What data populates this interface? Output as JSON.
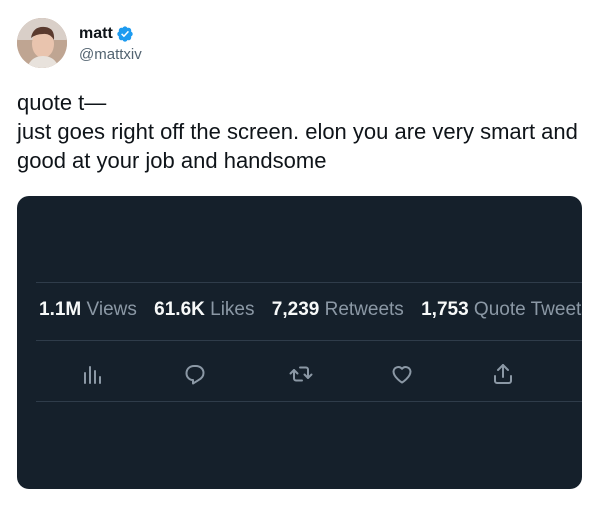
{
  "author": {
    "display_name": "matt",
    "handle": "@mattxiv",
    "avatar_icon": "profile-photo",
    "verified_icon": "verified-badge-icon"
  },
  "tweet": {
    "lines": [
      "quote t—",
      "just goes right off the screen. elon you are very smart and good at your job and handsome"
    ]
  },
  "embed": {
    "background": "#15202b",
    "stats": [
      {
        "value": "1.1M",
        "label": "Views"
      },
      {
        "value": "61.6K",
        "label": "Likes"
      },
      {
        "value": "7,239",
        "label": "Retweets"
      },
      {
        "value": "1,753",
        "label": "Quote Tweets"
      }
    ],
    "actions": [
      {
        "icon": "analytics-icon"
      },
      {
        "icon": "reply-icon"
      },
      {
        "icon": "retweet-icon"
      },
      {
        "icon": "like-icon"
      },
      {
        "icon": "share-icon"
      }
    ]
  },
  "colors": {
    "verified": "#1d9bf0",
    "text_primary": "#0f1419",
    "text_secondary": "#536471",
    "embed_value": "#f7f9f9",
    "embed_label": "#8b98a5",
    "embed_icon": "#8b98a5"
  }
}
